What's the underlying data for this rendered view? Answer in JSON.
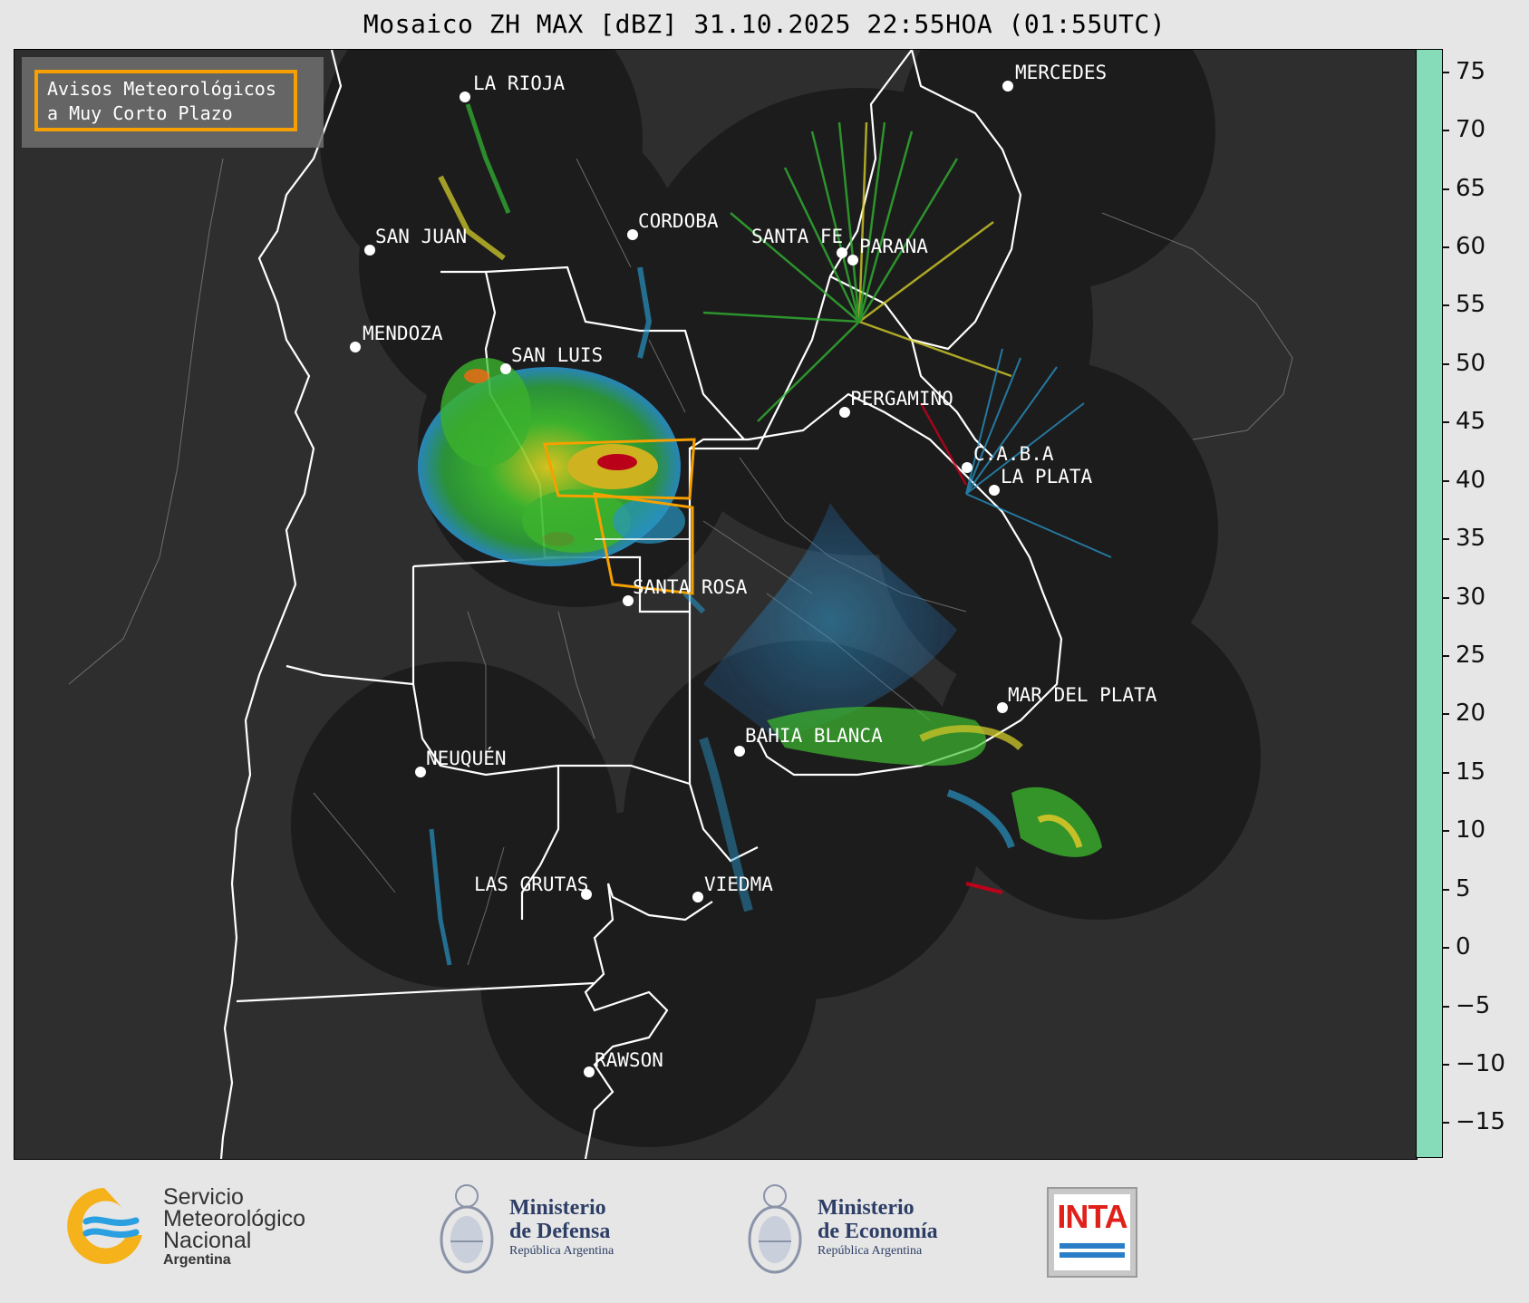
{
  "title": "Mosaico ZH MAX [dBZ] 31.10.2025 22:55HOA (01:55UTC)",
  "warning_box": {
    "line1": "Avisos Meteorológicos",
    "line2": "a Muy Corto Plazo",
    "color": "#f5a000"
  },
  "cities": [
    {
      "name": "LA RIOJA"
    },
    {
      "name": "SAN JUAN"
    },
    {
      "name": "CORDOBA"
    },
    {
      "name": "SANTA FE"
    },
    {
      "name": "PARANA"
    },
    {
      "name": "MENDOZA"
    },
    {
      "name": "SAN LUIS"
    },
    {
      "name": "PERGAMINO"
    },
    {
      "name": "C.A.B.A"
    },
    {
      "name": "LA PLATA"
    },
    {
      "name": "SANTA ROSA"
    },
    {
      "name": "MERCEDES"
    },
    {
      "name": "MAR DEL PLATA"
    },
    {
      "name": "BAHIA BLANCA"
    },
    {
      "name": "NEUQUÉN"
    },
    {
      "name": "LAS GRUTAS"
    },
    {
      "name": "VIEDMA"
    },
    {
      "name": "RAWSON"
    }
  ],
  "colorbar": {
    "unit": "dBZ",
    "min": -18,
    "max": 77,
    "tick_labels": [
      "75",
      "70",
      "65",
      "60",
      "55",
      "50",
      "45",
      "40",
      "35",
      "30",
      "25",
      "20",
      "15",
      "10",
      "5",
      "0",
      "−5",
      "−10",
      "−15"
    ],
    "tick_values": [
      75,
      70,
      65,
      60,
      55,
      50,
      45,
      40,
      35,
      30,
      25,
      20,
      15,
      10,
      5,
      0,
      -5,
      -10,
      -15
    ],
    "colors": [
      {
        "from": -18,
        "to": 0,
        "color": "#3a4a7a"
      },
      {
        "from": 0,
        "to": 10,
        "color": "#2f6aa0"
      },
      {
        "from": 10,
        "to": 18,
        "color": "#2a9bd0"
      },
      {
        "from": 18,
        "to": 30,
        "color": "#33b533"
      },
      {
        "from": 30,
        "to": 40,
        "color": "#d6cf2a"
      },
      {
        "from": 40,
        "to": 45,
        "color": "#e07a18"
      },
      {
        "from": 45,
        "to": 50,
        "color": "#c8001a"
      },
      {
        "from": 50,
        "to": 58,
        "color": "#cc00cc"
      },
      {
        "from": 58,
        "to": 60,
        "color": "#ffffff"
      },
      {
        "from": 60,
        "to": 77,
        "color": "#86dcb8"
      }
    ]
  },
  "footer": {
    "smn": {
      "line1": "Servicio",
      "line2": "Meteorológico",
      "line3": "Nacional",
      "line4": "Argentina"
    },
    "defensa": {
      "line1": "Ministerio",
      "line2": "de Defensa",
      "line3": "República Argentina"
    },
    "economia": {
      "line1": "Ministerio",
      "line2": "de Economía",
      "line3": "República Argentina"
    },
    "inta": {
      "text": "INTA"
    }
  }
}
